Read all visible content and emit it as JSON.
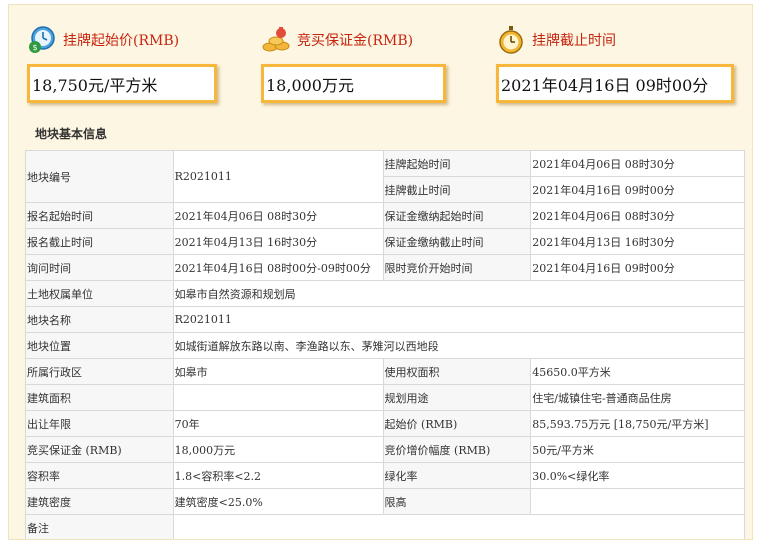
{
  "summary": {
    "start_price": {
      "label": "挂牌起始价(RMB)",
      "value": "18,750元/平方米",
      "icon": "money-clock-icon"
    },
    "deposit": {
      "label": "竞买保证金(RMB)",
      "value": "18,000万元",
      "icon": "gold-coins-icon"
    },
    "deadline": {
      "label": "挂牌截止时间",
      "value": "2021年04月16日  09时00分",
      "icon": "alarm-clock-icon"
    }
  },
  "section_title": "地块基本信息",
  "table": {
    "parcel_no": {
      "label": "地块编号",
      "value": "R2021011"
    },
    "listing_start": {
      "label": "挂牌起始时间",
      "value": "2021年04月06日 08时30分"
    },
    "listing_end": {
      "label": "挂牌截止时间",
      "value": "2021年04月16日 09时00分"
    },
    "reg_start": {
      "label": "报名起始时间",
      "value": "2021年04月06日 08时30分"
    },
    "deposit_start": {
      "label": "保证金缴纳起始时间",
      "value": "2021年04月06日 08时30分"
    },
    "reg_end": {
      "label": "报名截止时间",
      "value": "2021年04月13日 16时30分"
    },
    "deposit_end": {
      "label": "保证金缴纳截止时间",
      "value": "2021年04月13日 16时30分"
    },
    "inquiry": {
      "label": "询问时间",
      "value": "2021年04月16日 08时00分-09时00分"
    },
    "bid_start": {
      "label": "限时竞价开始时间",
      "value": "2021年04月16日 09时00分"
    },
    "owner": {
      "label": "土地权属单位",
      "value": "如皋市自然资源和规划局"
    },
    "name": {
      "label": "地块名称",
      "value": "R2021011"
    },
    "location": {
      "label": "地块位置",
      "value": "如城街道解放东路以南、李渔路以东、茅雉河以西地段"
    },
    "district": {
      "label": "所属行政区",
      "value": "如皋市"
    },
    "use_area": {
      "label": "使用权面积",
      "value": "45650.0平方米"
    },
    "build_area": {
      "label": "建筑面积",
      "value": ""
    },
    "planned_use": {
      "label": "规划用途",
      "value": "住宅/城镇住宅-普通商品住房"
    },
    "term": {
      "label": "出让年限",
      "value": "70年"
    },
    "start_price": {
      "label": "起始价 (RMB)",
      "value": "85,593.75万元 [18,750元/平方米]"
    },
    "deposit": {
      "label": "竞买保证金 (RMB)",
      "value": "18,000万元"
    },
    "increment": {
      "label": "竞价增价幅度 (RMB)",
      "value": "50元/平方米"
    },
    "far": {
      "label": "容积率",
      "value": "1.8<容积率<2.2"
    },
    "green": {
      "label": "绿化率",
      "value": "30.0%<绿化率"
    },
    "density": {
      "label": "建筑密度",
      "value": "建筑密度<25.0%"
    },
    "height": {
      "label": "限高",
      "value": ""
    },
    "remarks": {
      "label": "备注",
      "value": ""
    }
  }
}
